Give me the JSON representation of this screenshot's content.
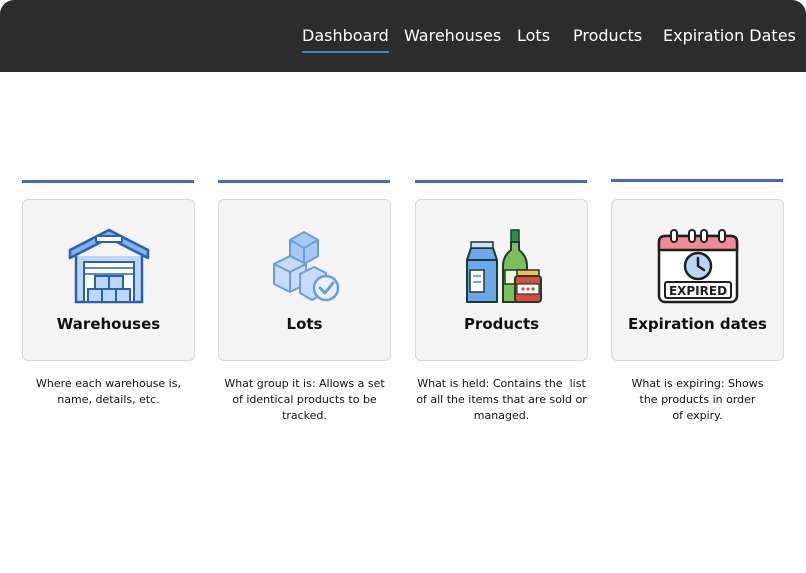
{
  "nav": {
    "items": [
      {
        "label": "Dashboard",
        "active": true
      },
      {
        "label": "Warehouses",
        "active": false
      },
      {
        "label": "Lots",
        "active": false
      },
      {
        "label": "Products",
        "active": false
      },
      {
        "label": "Expiration Dates",
        "active": false
      }
    ]
  },
  "cards": [
    {
      "title": "Warehouses",
      "icon": "warehouse-icon",
      "description": [
        "Where each warehouse is,",
        "name, details, etc."
      ]
    },
    {
      "title": "Lots",
      "icon": "boxes-check-icon",
      "description": [
        "What group it is: Allows a set",
        "of identical products to be",
        "tracked."
      ]
    },
    {
      "title": "Products",
      "icon": "grocery-products-icon",
      "description": [
        "What is held: Contains the  list",
        "of all the items that are sold or",
        "managed."
      ]
    },
    {
      "title": "Expiration dates",
      "icon": "expired-calendar-icon",
      "description": [
        "What is expiring: Shows",
        "the products in order",
        "of expiry."
      ]
    }
  ],
  "colors": {
    "topbar": "#2c2c2c",
    "accent": "#4a6ab8",
    "nav_underline": "#4a7cd0",
    "card_bg": "#f4f4f4"
  }
}
